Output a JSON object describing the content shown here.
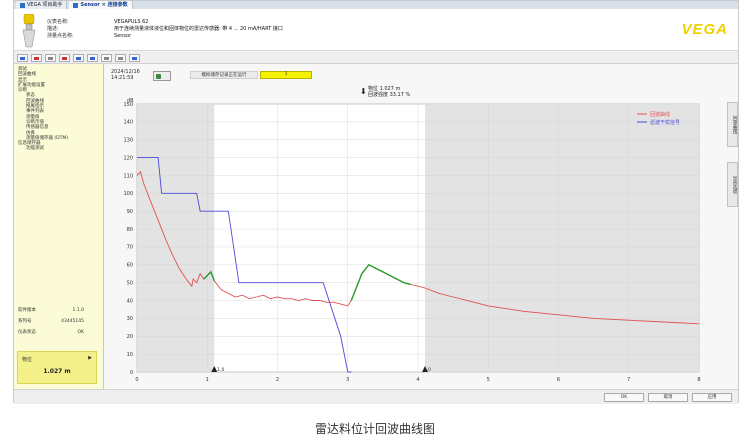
{
  "tabs": [
    {
      "label": "VEGA 项目助手",
      "active": false
    },
    {
      "label": "Sensor × 连接参数",
      "active": true
    }
  ],
  "header": {
    "labels": [
      "仪表名称:",
      "描述:",
      "测量点名称:"
    ],
    "values": [
      "VEGAPULS 62",
      "用于连续测量液体液位和固体物位的雷达传感器: 带 4 ... 20 mA/HART 接口",
      "Sensor"
    ],
    "logo": "VEGA"
  },
  "sidebar": {
    "tree": [
      {
        "label": "调试",
        "level": 1
      },
      {
        "label": "回波曲线",
        "level": 1
      },
      {
        "label": "显示",
        "level": 1
      },
      {
        "label": "扩展功能设置",
        "level": 1
      },
      {
        "label": "诊断",
        "level": 1
      },
      {
        "label": "状态",
        "level": 2
      },
      {
        "label": "回波曲线",
        "level": 2
      },
      {
        "label": "拖尾指示",
        "level": 2
      },
      {
        "label": "事件列表",
        "level": 2
      },
      {
        "label": "测量值",
        "level": 2
      },
      {
        "label": "诊断示值",
        "level": 2
      },
      {
        "label": "传感器信息",
        "level": 2
      },
      {
        "label": "仿真",
        "level": 2
      },
      {
        "label": "测量值储存器 (DTM)",
        "level": 2
      },
      {
        "label": "信息储存器",
        "level": 1
      },
      {
        "label": "功能测试",
        "level": 2
      }
    ],
    "info": [
      {
        "label": "软件版本",
        "value": "1.1.0"
      },
      {
        "label": "系列号",
        "value": "43445145"
      },
      {
        "label": "仪表状态",
        "value": "OK"
      }
    ],
    "measurement": {
      "label": "物位",
      "value": "1.027 m"
    }
  },
  "main": {
    "date": "2024/12/16",
    "time": "14:21:59",
    "status_text": "模拟储存记录正在运行",
    "status_bar_text": "1",
    "readout": {
      "line1": "物位 1.027 m",
      "line2": "回波强度 33.17 %"
    }
  },
  "side_tabs": [
    "回波曲线",
    "显示选项"
  ],
  "footer": {
    "buttons": [
      "OK",
      "取消",
      "应用"
    ]
  },
  "caption": "雷达料位计回波曲线图",
  "chart_data": {
    "type": "line",
    "xlabel": "",
    "ylabel": "dB",
    "xlim": [
      0,
      8
    ],
    "ylim": [
      0,
      150
    ],
    "xticks": [
      0,
      1,
      2,
      3,
      4,
      5,
      6,
      7,
      8
    ],
    "yticks": [
      0,
      10,
      20,
      30,
      40,
      50,
      60,
      70,
      80,
      90,
      100,
      110,
      120,
      130,
      140,
      150
    ],
    "legend": [
      "回波曲线",
      "滤波干扰信号"
    ],
    "legend_position": "top-right",
    "shaded_regions": [
      [
        0,
        1.1
      ],
      [
        4.1,
        8
      ]
    ],
    "markers": [
      {
        "x": 1.1,
        "label": "1.0"
      },
      {
        "x": 4.1,
        "label": "0"
      }
    ],
    "series": [
      {
        "name": "回波曲线",
        "color": "#e05050",
        "x": [
          0,
          0.05,
          0.1,
          0.2,
          0.3,
          0.4,
          0.5,
          0.6,
          0.7,
          0.78,
          0.8,
          0.85,
          0.9,
          0.95,
          1.0,
          1.05,
          1.1,
          1.2,
          1.3,
          1.4,
          1.5,
          1.6,
          1.7,
          1.8,
          1.9,
          2.0,
          2.1,
          2.2,
          2.3,
          2.4,
          2.5,
          2.6,
          2.7,
          2.8,
          2.9,
          3.0,
          3.05,
          3.1,
          3.2,
          3.3,
          3.4,
          3.5,
          3.6,
          3.7,
          3.8,
          3.9,
          4.0,
          4.1,
          4.3,
          4.5,
          4.8,
          5.0,
          5.5,
          6.0,
          6.5,
          7.0,
          7.5,
          8.0
        ],
        "y": [
          110,
          112,
          105,
          95,
          85,
          75,
          66,
          58,
          52,
          48,
          52,
          50,
          55,
          52,
          54,
          56,
          51,
          46,
          44,
          42,
          43,
          41,
          42,
          43,
          41,
          42,
          41,
          41,
          40,
          41,
          40,
          40,
          39,
          39,
          38,
          37,
          40,
          45,
          55,
          60,
          58,
          56,
          54,
          52,
          50,
          49,
          48,
          47,
          44,
          42,
          39,
          37,
          34,
          32,
          30,
          29,
          28,
          27
        ]
      },
      {
        "name": "滤波干扰信号",
        "color": "#4a4ad8",
        "x": [
          0,
          0.3,
          0.35,
          0.85,
          0.9,
          1.3,
          1.45,
          2.6,
          2.65,
          2.9,
          3.0,
          3.05
        ],
        "y": [
          120,
          120,
          100,
          100,
          90,
          90,
          50,
          50,
          50,
          20,
          0,
          0
        ]
      },
      {
        "name": "",
        "color": "#2a9a2a",
        "x": [
          0.95,
          1.0,
          1.05,
          1.1
        ],
        "y": [
          52,
          54,
          56,
          51
        ]
      },
      {
        "name": "",
        "color": "#2a9a2a",
        "x": [
          3.05,
          3.1,
          3.2,
          3.3,
          3.4,
          3.5,
          3.6,
          3.7,
          3.8,
          3.9
        ],
        "y": [
          40,
          45,
          55,
          60,
          58,
          56,
          54,
          52,
          50,
          49
        ]
      }
    ]
  }
}
